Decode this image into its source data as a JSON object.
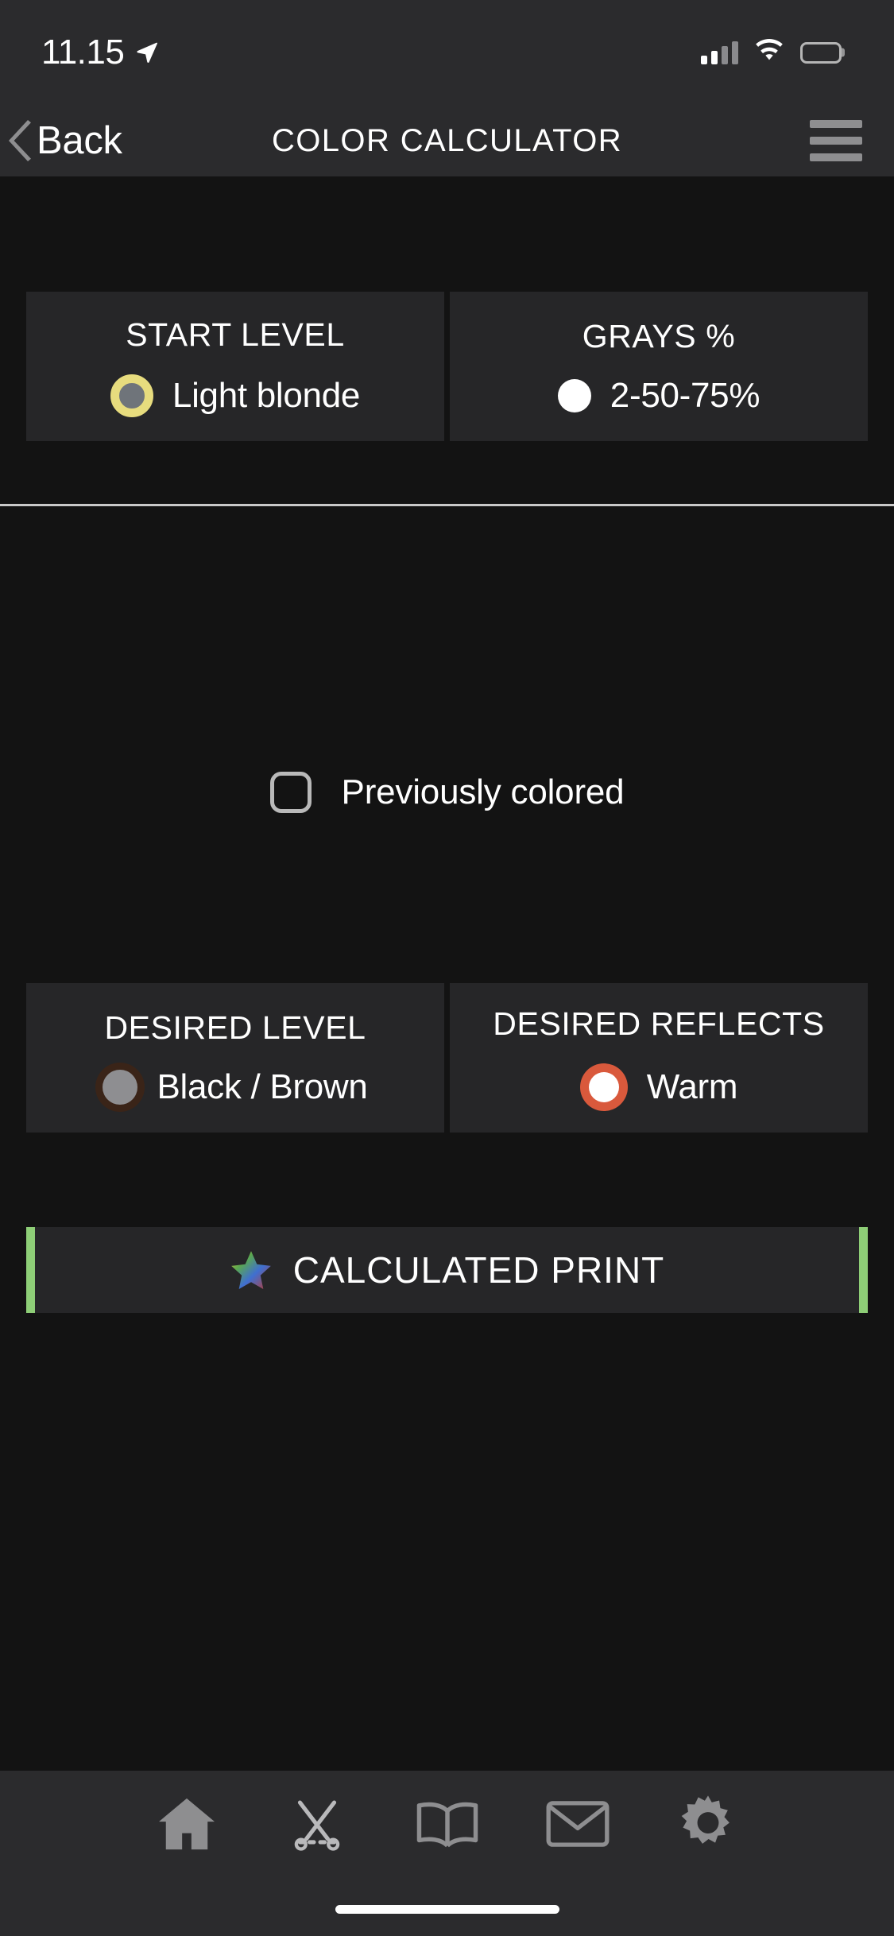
{
  "statusbar": {
    "time": "11.15",
    "location_icon": "location-arrow-icon",
    "cellular_icon": "cellular-signal-icon",
    "cellular_bars": 2,
    "wifi_icon": "wifi-icon",
    "battery_icon": "battery-full-icon"
  },
  "navbar": {
    "back_label": "Back",
    "back_icon": "chevron-left-icon",
    "title": "COLOR CALCULATOR",
    "menu_icon": "hamburger-menu-icon"
  },
  "start_section": {
    "cards": [
      {
        "title": "START LEVEL",
        "value": "Light blonde",
        "swatch_icon": "color-swatch-icon",
        "swatch_ring_color": "#e7dc7e",
        "swatch_fill_color": "#6f747a"
      },
      {
        "title": "GRAYS %",
        "value": "2-50-75%",
        "swatch_icon": "color-swatch-icon",
        "swatch_fill_color": "#ffffff"
      }
    ],
    "checkbox": {
      "label": "Previously colored",
      "icon": "checkbox-unchecked-icon",
      "checked": false
    }
  },
  "desired_section": {
    "cards": [
      {
        "title": "DESIRED LEVEL",
        "value": "Black / Brown",
        "swatch_icon": "color-swatch-icon",
        "swatch_ring_color": "#3a2418",
        "swatch_fill_color": "#8e8e91"
      },
      {
        "title": "DESIRED REFLECTS",
        "value": "Warm",
        "swatch_icon": "color-swatch-icon",
        "swatch_ring_color": "#d9593c",
        "swatch_fill_color": "#ffffff"
      }
    ],
    "print_button": {
      "label": "CALCULATED PRINT",
      "icon": "multicolor-star-icon",
      "accent_color": "#8ece77"
    }
  },
  "tabbar": {
    "items": [
      {
        "icon": "home-icon"
      },
      {
        "icon": "scissors-comb-icon"
      },
      {
        "icon": "book-icon"
      },
      {
        "icon": "mail-icon"
      },
      {
        "icon": "gear-icon"
      }
    ]
  },
  "home_indicator": {
    "icon": "home-indicator-bar"
  }
}
